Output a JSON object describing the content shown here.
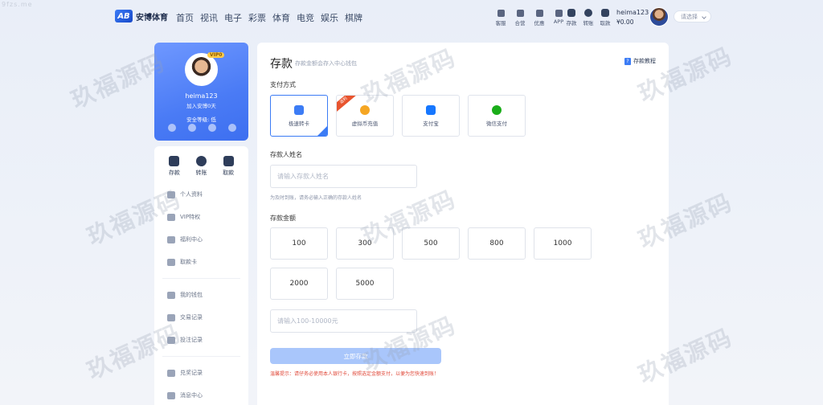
{
  "corner_mark": "9fzs.me",
  "header": {
    "logo_text": "安博体育",
    "logo_mark": "AB",
    "nav": [
      "首页",
      "视讯",
      "电子",
      "彩票",
      "体育",
      "电竞",
      "娱乐",
      "棋牌"
    ],
    "tools": [
      {
        "icon": "customer-service-icon",
        "label": "客服"
      },
      {
        "icon": "agency-icon",
        "label": "合营"
      },
      {
        "icon": "gift-icon",
        "label": "优惠"
      },
      {
        "icon": "phone-icon",
        "label": "APP"
      }
    ],
    "wallet_tools": [
      {
        "icon": "deposit-icon",
        "label": "存款"
      },
      {
        "icon": "transfer-icon",
        "label": "转账"
      },
      {
        "icon": "withdraw-icon",
        "label": "取款"
      }
    ],
    "username": "heima123",
    "balance": "¥0.00",
    "language_placeholder": "请选择"
  },
  "profile": {
    "vip": "VIP0",
    "username": "heima123",
    "joined": "加入安博0天",
    "safety": "安全等级: 低"
  },
  "sidebar": {
    "quick": [
      {
        "icon": "deposit-icon",
        "label": "存款"
      },
      {
        "icon": "transfer-icon",
        "label": "转账"
      },
      {
        "icon": "withdraw-icon",
        "label": "取款"
      }
    ],
    "group1": [
      {
        "icon": "user-icon",
        "label": "个人资料"
      },
      {
        "icon": "diamond-icon",
        "label": "VIP特权"
      },
      {
        "icon": "gift-icon",
        "label": "福利中心"
      },
      {
        "icon": "card-icon",
        "label": "取款卡"
      }
    ],
    "group2": [
      {
        "icon": "wallet-icon",
        "label": "我的钱包"
      },
      {
        "icon": "transaction-icon",
        "label": "交易记录"
      },
      {
        "icon": "bet-icon",
        "label": "投注记录"
      }
    ],
    "group3": [
      {
        "icon": "exchange-icon",
        "label": "兑奖记录"
      },
      {
        "icon": "message-icon",
        "label": "消息中心"
      }
    ]
  },
  "main": {
    "title": "存款",
    "subtitle": "存款金额会存入中心钱包",
    "tutorial": "存款教程",
    "payment_label": "支付方式",
    "payments": [
      {
        "label": "极速转卡",
        "color": "#3c7cf5",
        "active": true
      },
      {
        "label": "虚拟币充值",
        "color": "#f5a623",
        "badge": "返利"
      },
      {
        "label": "支付宝",
        "color": "#1677ff"
      },
      {
        "label": "微信支付",
        "color": "#1aad19"
      }
    ],
    "name_label": "存款人姓名",
    "name_placeholder": "请输入存款人姓名",
    "name_hint": "为及时到账，请务必输入正确的存款人姓名",
    "amount_label": "存款金额",
    "amounts": [
      "100",
      "300",
      "500",
      "800",
      "1000",
      "2000",
      "5000"
    ],
    "amount_placeholder": "请输入100-10000元",
    "submit": "立即存款",
    "warning": "温馨提示：请仔务必使用本人银行卡，按照选定金额支付，以便为您快速到账！"
  },
  "watermark": "玖福源码",
  "colors": {
    "accent": "#3c7cf5",
    "profile_gradient_start": "#6f98ff",
    "profile_gradient_end": "#3d6ff0",
    "submit_disabled": "#a9c6fb",
    "warning": "#e0493a"
  }
}
